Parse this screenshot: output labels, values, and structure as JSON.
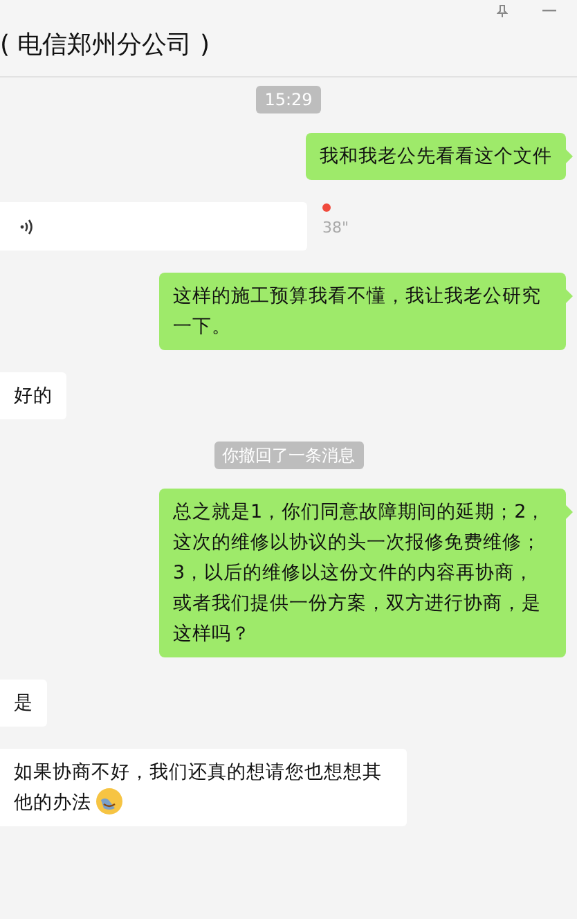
{
  "window": {
    "title": "( 电信郑州分公司 )"
  },
  "messages": [
    {
      "kind": "notice",
      "text": "15:29"
    },
    {
      "kind": "text",
      "outgoing": true,
      "text": "我和我老公先看看这个文件",
      "emoji": false
    },
    {
      "kind": "voice",
      "outgoing": false,
      "duration": "38\"",
      "unread": true
    },
    {
      "kind": "text",
      "outgoing": true,
      "text": "这样的施工预算我看不懂，我让我老公研究一下。",
      "emoji": false
    },
    {
      "kind": "text",
      "outgoing": false,
      "text": "好的",
      "emoji": false
    },
    {
      "kind": "notice",
      "text": "你撤回了一条消息"
    },
    {
      "kind": "text",
      "outgoing": true,
      "text": "总之就是1，你们同意故障期间的延期；2，这次的维修以协议的头一次报修免费维修；3，以后的维修以这份文件的内容再协商，或者我们提供一份方案，双方进行协商，是这样吗？",
      "emoji": false
    },
    {
      "kind": "text",
      "outgoing": false,
      "text": "是",
      "emoji": false
    },
    {
      "kind": "text",
      "outgoing": false,
      "text": "如果协商不好，我们还真的想请您也想想其他的办法",
      "emoji": true
    }
  ]
}
